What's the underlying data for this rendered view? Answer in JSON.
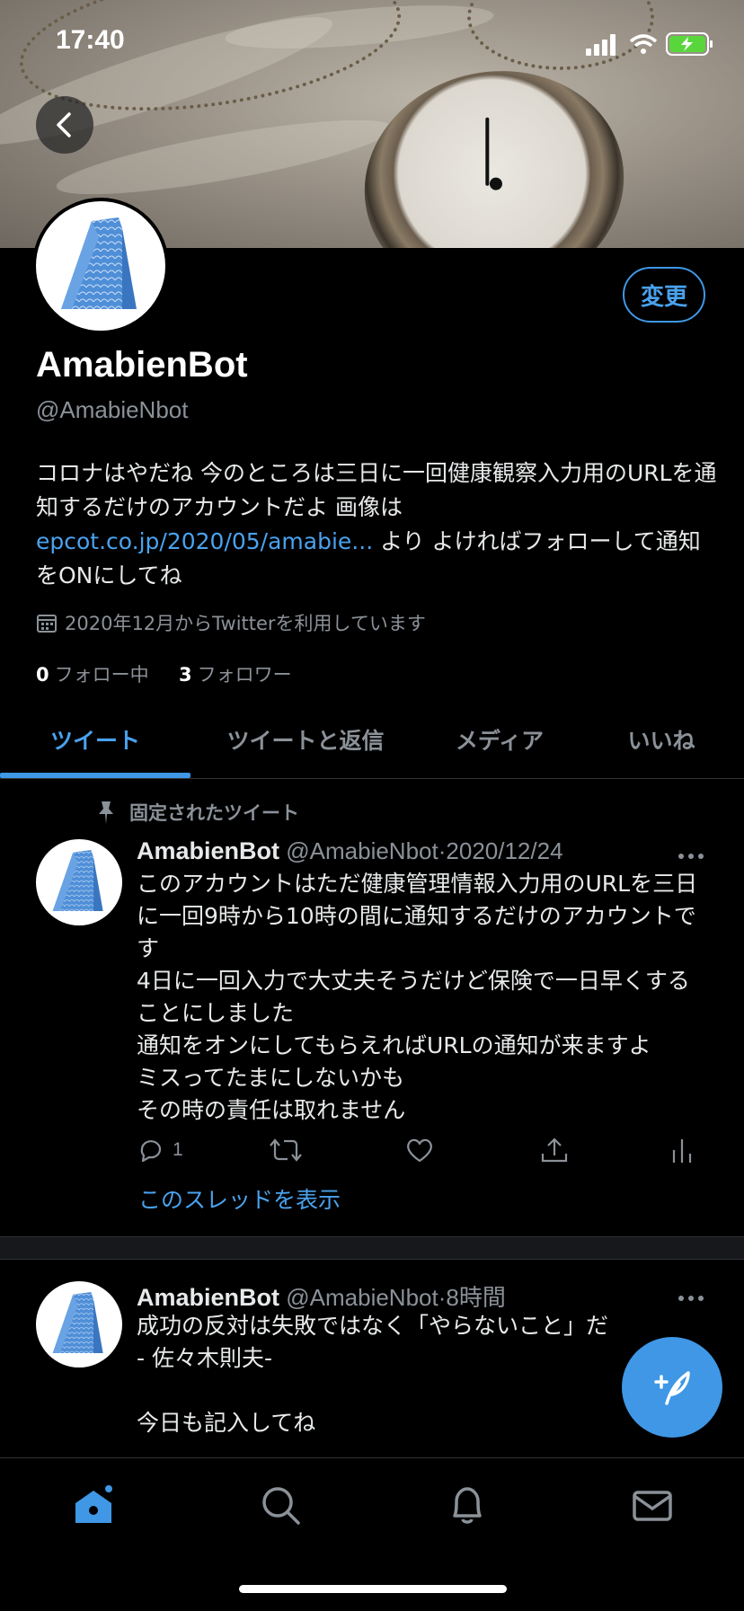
{
  "status_bar": {
    "time": "17:40"
  },
  "profile": {
    "edit_label": "変更",
    "name": "AmabienBot",
    "handle": "@AmabieNbot",
    "bio_part1": "コロナはやだね 今のところは三日に一回健康観察入力用のURLを通知するだけのアカウントだよ 画像は ",
    "bio_link": "epcot.co.jp/2020/05/amabie...",
    "bio_part2": " より よければフォローして通知をONにしてね",
    "joined": "2020年12月からTwitterを利用しています",
    "following_count": "0",
    "following_label": "フォロー中",
    "followers_count": "3",
    "followers_label": "フォロワー"
  },
  "tabs": [
    {
      "label": "ツイート",
      "active": true
    },
    {
      "label": "ツイートと返信",
      "active": false
    },
    {
      "label": "メディア",
      "active": false
    },
    {
      "label": "いいね",
      "active": false
    }
  ],
  "pinned_label": "固定されたツイート",
  "tweets": [
    {
      "name": "AmabienBot",
      "handle": "@AmabieNbot",
      "time": "2020/12/24",
      "text": "このアカウントはただ健康管理情報入力用のURLを三日に一回9時から10時の間に通知するだけのアカウントです\n4日に一回入力で大丈夫そうだけど保険で一日早くすることにしました\n通知をオンにしてもらえればURLの通知が来ますよ\nミスってたまにしないかも\nその時の責任は取れません",
      "reply_count": "1",
      "thread_link": "このスレッドを表示"
    },
    {
      "name": "AmabienBot",
      "handle": "@AmabieNbot",
      "time": "8時間",
      "text": "成功の反対は失敗ではなく「やらないこと」だ\n- 佐々木則夫-\n\n今日も記入してね"
    }
  ],
  "colors": {
    "accent": "#3f97e6",
    "background": "#000000",
    "muted": "#8b9198"
  },
  "icons": [
    "back-arrow-icon",
    "calendar-icon",
    "pin-icon",
    "reply-icon",
    "retweet-icon",
    "like-icon",
    "share-icon",
    "analytics-icon",
    "more-icon",
    "compose-icon",
    "home-icon",
    "search-icon",
    "bell-icon",
    "mail-icon"
  ]
}
